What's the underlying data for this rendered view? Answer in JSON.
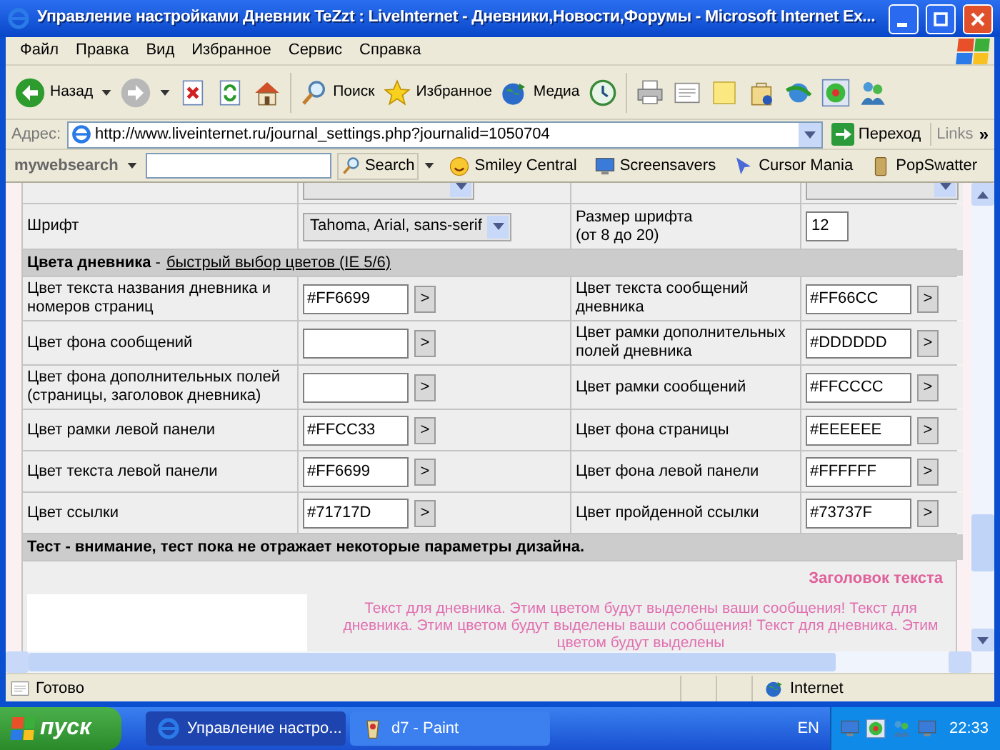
{
  "window": {
    "title": "Управление настройками Дневник TeZzt : LiveInternet - Дневники,Новости,Форумы - Microsoft Internet Ex..."
  },
  "menu": [
    "Файл",
    "Правка",
    "Вид",
    "Избранное",
    "Сервис",
    "Справка"
  ],
  "toolbar": [
    {
      "kind": "back",
      "label": "Назад",
      "dropdown": true
    },
    {
      "kind": "forward",
      "dropdown": true
    },
    {
      "kind": "stop"
    },
    {
      "kind": "refresh"
    },
    {
      "kind": "home"
    },
    {
      "kind": "search",
      "label": "Поиск"
    },
    {
      "kind": "star",
      "label": "Избранное"
    },
    {
      "kind": "globe",
      "label": "Медиа"
    },
    {
      "kind": "history"
    },
    {
      "kind": "print"
    },
    {
      "kind": "edit"
    },
    {
      "kind": "note"
    },
    {
      "kind": "bag"
    },
    {
      "kind": "messenger"
    },
    {
      "kind": "flower"
    },
    {
      "kind": "people"
    }
  ],
  "address": {
    "label": "Адрес:",
    "url": "http://www.liveinternet.ru/journal_settings.php?journalid=1050704",
    "go": "Переход",
    "links": "Links",
    "more": "»"
  },
  "search_bar": {
    "brand": "my**web**search",
    "button": "Search",
    "items": [
      {
        "kind": "smiley",
        "label": "Smiley Central"
      },
      {
        "kind": "monitor",
        "label": "Screensavers"
      },
      {
        "kind": "cursor",
        "label": "Cursor Mania"
      },
      {
        "kind": "popper",
        "label": "PopSwatter"
      }
    ]
  },
  "settings": {
    "rows": [
      {
        "kind": "fields",
        "left_field": {
          "kind": "select"
        },
        "right_field": {
          "kind": "select"
        }
      },
      {
        "kind": "fields",
        "left_label": "Шрифт",
        "left_field": {
          "kind": "select",
          "value": "Tahoma, Arial, sans-serif"
        },
        "right_label": "Размер шрифта\n(от 8 до 20)",
        "right_field": {
          "kind": "number",
          "value": "12"
        }
      },
      {
        "kind": "header",
        "title": "**Цвета дневника** -",
        "link": "быстрый выбор цветов (IE 5/6)"
      },
      {
        "kind": "fields",
        "left_label": "Цвет текста названия дневника и\nномеров страниц",
        "left_field": {
          "kind": "color",
          "value": "#FF6699",
          "button": ">"
        },
        "right_label": "Цвет текста сообщений\nдневника",
        "right_field": {
          "kind": "color",
          "value": "#FF66CC",
          "button": ">"
        }
      },
      {
        "kind": "fields",
        "left_label": "Цвет фона сообщений",
        "left_field": {
          "kind": "color",
          "button": ">"
        },
        "right_label": "Цвет рамки дополнительных\nполей дневника",
        "right_field": {
          "kind": "color",
          "value": "#DDDDDD",
          "button": ">"
        }
      },
      {
        "kind": "fields",
        "left_label": "Цвет фона дополнительных полей\n(страницы, заголовок дневника)",
        "left_field": {
          "kind": "color",
          "button": ">"
        },
        "right_label": "Цвет рамки сообщений",
        "right_field": {
          "kind": "color",
          "value": "#FFCCCC",
          "button": ">"
        }
      },
      {
        "kind": "fields",
        "left_label": "Цвет рамки левой панели",
        "left_field": {
          "kind": "color",
          "value": "#FFCC33",
          "button": ">"
        },
        "right_label": "Цвет фона страницы",
        "right_field": {
          "kind": "color",
          "value": "#EEEEEE",
          "button": ">"
        }
      },
      {
        "kind": "fields",
        "left_label": "Цвет текста левой панели",
        "left_field": {
          "kind": "color",
          "value": "#FF6699",
          "button": ">"
        },
        "right_label": "Цвет фона левой панели",
        "right_field": {
          "kind": "color",
          "value": "#FFFFFF",
          "button": ">"
        }
      },
      {
        "kind": "fields",
        "left_label": "Цвет ссылки",
        "left_field": {
          "kind": "color",
          "value": "#71717D",
          "button": ">"
        },
        "right_label": "Цвет пройденной ссылки",
        "right_field": {
          "kind": "color",
          "value": "#73737F",
          "button": ">"
        }
      },
      {
        "kind": "header",
        "title": "Тест - внимание, тест пока не отражает некоторые параметры дизайна."
      }
    ]
  },
  "preview": {
    "heading": "Заголовок текста",
    "body": "Текст для дневника. Этим цветом будут выделены ваши сообщения! Текст для дневника. Этим цветом будут выделены ваши сообщения! Текст для дневника. Этим цветом будут выделены"
  },
  "status_bar": {
    "text": "Готово",
    "zone": "Internet"
  },
  "taskbar": {
    "start": "пуск",
    "tasks": [
      {
        "kind": "ie",
        "label": "Управление настро...",
        "selected": true
      },
      {
        "kind": "paint",
        "label": "d7 - Paint",
        "selected": false
      }
    ],
    "language": "EN",
    "time": "22:33"
  }
}
